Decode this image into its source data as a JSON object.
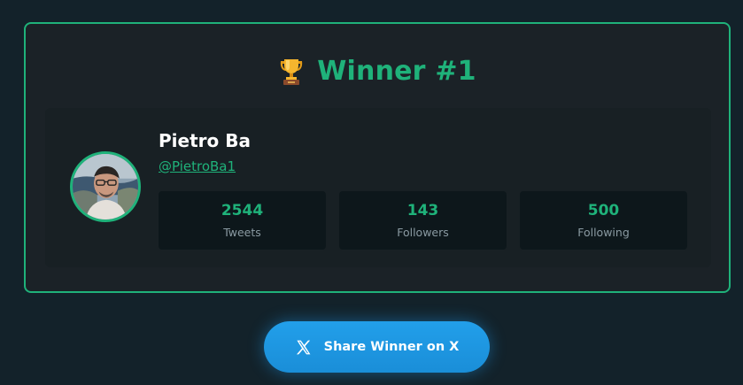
{
  "winner": {
    "title": "Winner #1",
    "trophy_icon": "trophy-icon",
    "name": "Pietro Ba",
    "handle": "@PietroBa1",
    "stats": [
      {
        "value": "2544",
        "label": "Tweets"
      },
      {
        "value": "143",
        "label": "Followers"
      },
      {
        "value": "500",
        "label": "Following"
      }
    ]
  },
  "share": {
    "label": "Share Winner on X",
    "icon": "x-logo-icon"
  },
  "colors": {
    "accent": "#1fb27a",
    "background": "#13222a",
    "card": "#1b2227",
    "button": "#1d9bf0"
  }
}
